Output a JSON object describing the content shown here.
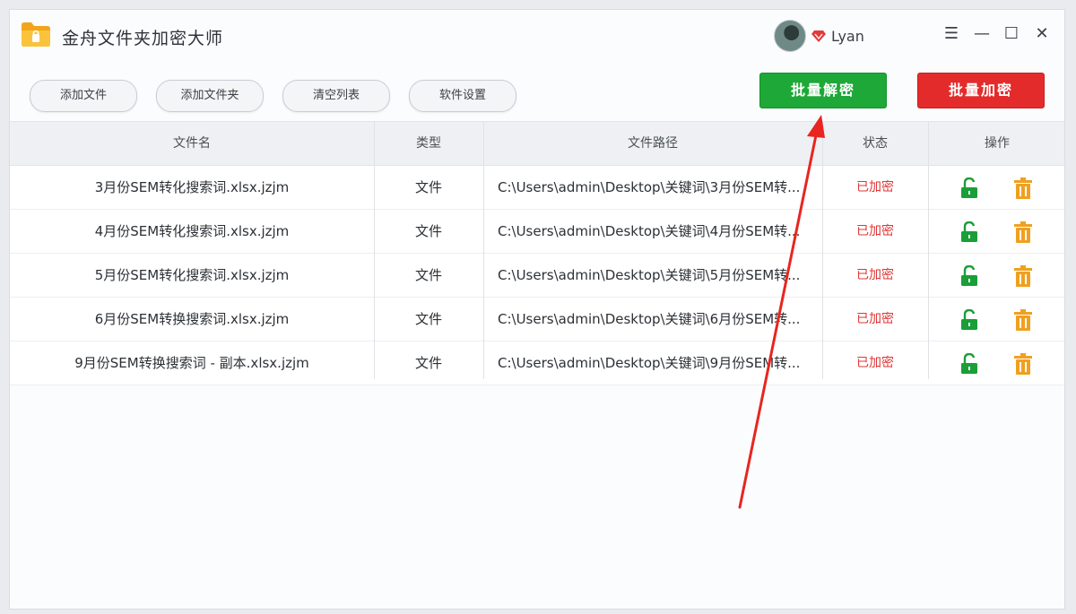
{
  "app": {
    "title": "金舟文件夹加密大师",
    "username": "Lyan"
  },
  "window_controls": {
    "menu": "☰",
    "minimize": "—",
    "maximize": "☐",
    "close": "✕"
  },
  "toolbar": {
    "add_file": "添加文件",
    "add_folder": "添加文件夹",
    "clear_list": "清空列表",
    "settings": "软件设置",
    "batch_decrypt": "批量解密",
    "batch_encrypt": "批量加密"
  },
  "table": {
    "headers": {
      "name": "文件名",
      "type": "类型",
      "path": "文件路径",
      "status": "状态",
      "ops": "操作"
    },
    "rows": [
      {
        "name": "3月份SEM转化搜索词.xlsx.jzjm",
        "type": "文件",
        "path": "C:\\Users\\admin\\Desktop\\关键词\\3月份SEM转...",
        "status": "已加密"
      },
      {
        "name": "4月份SEM转化搜索词.xlsx.jzjm",
        "type": "文件",
        "path": "C:\\Users\\admin\\Desktop\\关键词\\4月份SEM转...",
        "status": "已加密"
      },
      {
        "name": "5月份SEM转化搜索词.xlsx.jzjm",
        "type": "文件",
        "path": "C:\\Users\\admin\\Desktop\\关键词\\5月份SEM转...",
        "status": "已加密"
      },
      {
        "name": "6月份SEM转换搜索词.xlsx.jzjm",
        "type": "文件",
        "path": "C:\\Users\\admin\\Desktop\\关键词\\6月份SEM转...",
        "status": "已加密"
      },
      {
        "name": "9月份SEM转换搜索词 - 副本.xlsx.jzjm",
        "type": "文件",
        "path": "C:\\Users\\admin\\Desktop\\关键词\\9月份SEM转...",
        "status": "已加密"
      }
    ]
  },
  "colors": {
    "green": "#1ea838",
    "red": "#e42b2b",
    "status_red": "#e03535",
    "icon_orange": "#f0a020"
  },
  "icons": [
    "folder-logo-icon",
    "vip-diamond-icon",
    "unlock-icon",
    "delete-icon"
  ]
}
